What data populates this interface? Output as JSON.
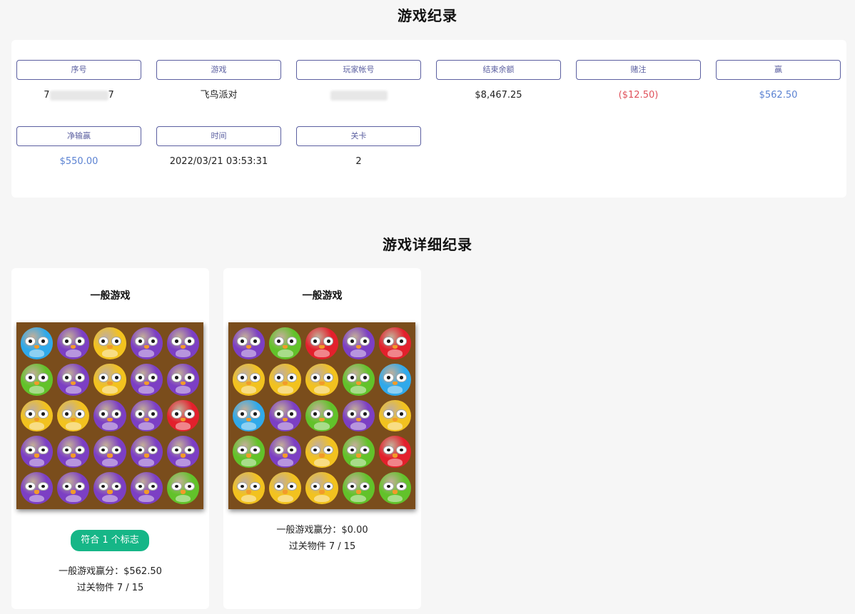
{
  "record": {
    "title": "游戏纪录",
    "fields": [
      {
        "label": "序号",
        "value_prefix": "7",
        "value_suffix": "7",
        "value": "",
        "masked": true
      },
      {
        "label": "游戏",
        "value": "飞鸟派对"
      },
      {
        "label": "玩家帐号",
        "value": "",
        "masked": true
      },
      {
        "label": "结束余额",
        "value": "$8,467.25"
      },
      {
        "label": "赌注",
        "value": "($12.50)",
        "color": "#e0515b"
      },
      {
        "label": "赢",
        "value": "$562.50",
        "color": "#5b82d2"
      },
      {
        "label": "净输赢",
        "value": "$550.00",
        "color": "#5b82d2"
      },
      {
        "label": "时间",
        "value": "2022/03/21 03:53:31"
      },
      {
        "label": "关卡",
        "value": "2"
      }
    ]
  },
  "details": {
    "title": "游戏详细纪录",
    "cards": [
      {
        "title": "一般游戏",
        "badge": "符合 1 个标志",
        "win_text": "一般游戏赢分：$562.50",
        "items_text": "过关物件 7 / 15",
        "grid": [
          [
            "blue",
            "purple",
            "yellow",
            "purple",
            "purple"
          ],
          [
            "green",
            "purple",
            "yellow",
            "purple",
            "purple"
          ],
          [
            "yellow",
            "yellow",
            "purple",
            "purple",
            "red"
          ],
          [
            "purple",
            "purple",
            "purple",
            "purple",
            "purple"
          ],
          [
            "purple",
            "purple",
            "purple",
            "purple",
            "green"
          ]
        ]
      },
      {
        "title": "一般游戏",
        "win_text": "一般游戏赢分：$0.00",
        "items_text": "过关物件 7 / 15",
        "grid": [
          [
            "purple",
            "green",
            "red",
            "purple",
            "red"
          ],
          [
            "yellow",
            "yellow",
            "yellow",
            "green",
            "blue"
          ],
          [
            "blue",
            "purple",
            "green",
            "purple",
            "yellow"
          ],
          [
            "green",
            "purple",
            "yellow",
            "green",
            "red"
          ],
          [
            "yellow",
            "yellow",
            "yellow",
            "green",
            "green"
          ]
        ]
      }
    ]
  },
  "colors": {
    "label_border": "#5b5fa0",
    "negative": "#e0515b",
    "positive": "#5b82d2",
    "badge": "#16b687",
    "board": "#7a4d1c",
    "bird_purple": "#7c3fc4",
    "bird_yellow": "#f2c21f",
    "bird_green": "#62c22a",
    "bird_red": "#e3202c",
    "bird_blue": "#30a9ea"
  }
}
